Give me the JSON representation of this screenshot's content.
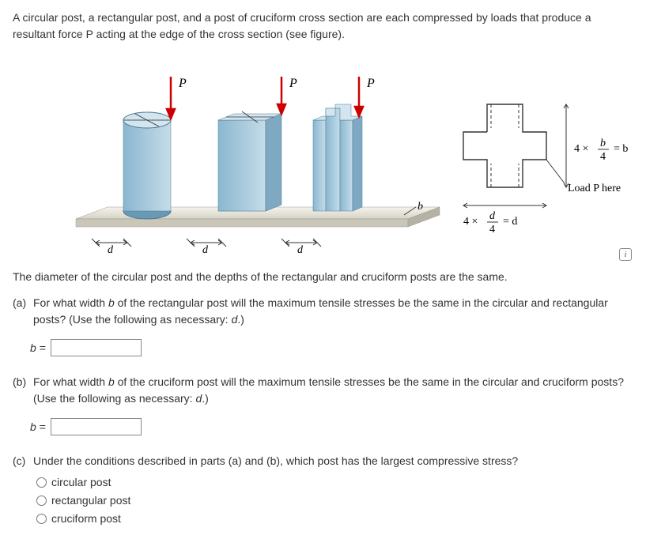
{
  "intro": "A circular post, a rectangular post, and a post of cruciform cross section are each compressed by loads that produce a resultant force P acting at the edge of the cross section (see figure).",
  "figure": {
    "p_label": "P",
    "d_label": "d",
    "b_label": "b",
    "eq1_left": "4 ×",
    "eq1_frac_top": "d",
    "eq1_frac_bot": "4",
    "eq1_right": "= d",
    "eq2_left": "4 ×",
    "eq2_frac_top": "b",
    "eq2_frac_bot": "4",
    "eq2_right": "= b",
    "load_text": "Load P here",
    "info_icon": "i"
  },
  "note": "The diameter of the circular post and the depths of the rectangular and cruciform posts are the same.",
  "parts": {
    "a": {
      "label": "(a)",
      "text_before": "For what width ",
      "var1": "b",
      "text_mid": " of the rectangular post will the maximum tensile stresses be the same in the circular and rectangular posts? (Use the following as necessary: ",
      "var2": "d",
      "text_after": ".)",
      "answer_prefix": "b =",
      "answer_value": ""
    },
    "b": {
      "label": "(b)",
      "text_before": "For what width ",
      "var1": "b",
      "text_mid": " of the cruciform post will the maximum tensile stresses be the same in the circular and cruciform posts? (Use the following as necessary: ",
      "var2": "d",
      "text_after": ".)",
      "answer_prefix": "b =",
      "answer_value": ""
    },
    "c": {
      "label": "(c)",
      "text": "Under the conditions described in parts (a) and (b), which post has the largest compressive stress?",
      "options": [
        "circular post",
        "rectangular post",
        "cruciform post"
      ]
    }
  }
}
